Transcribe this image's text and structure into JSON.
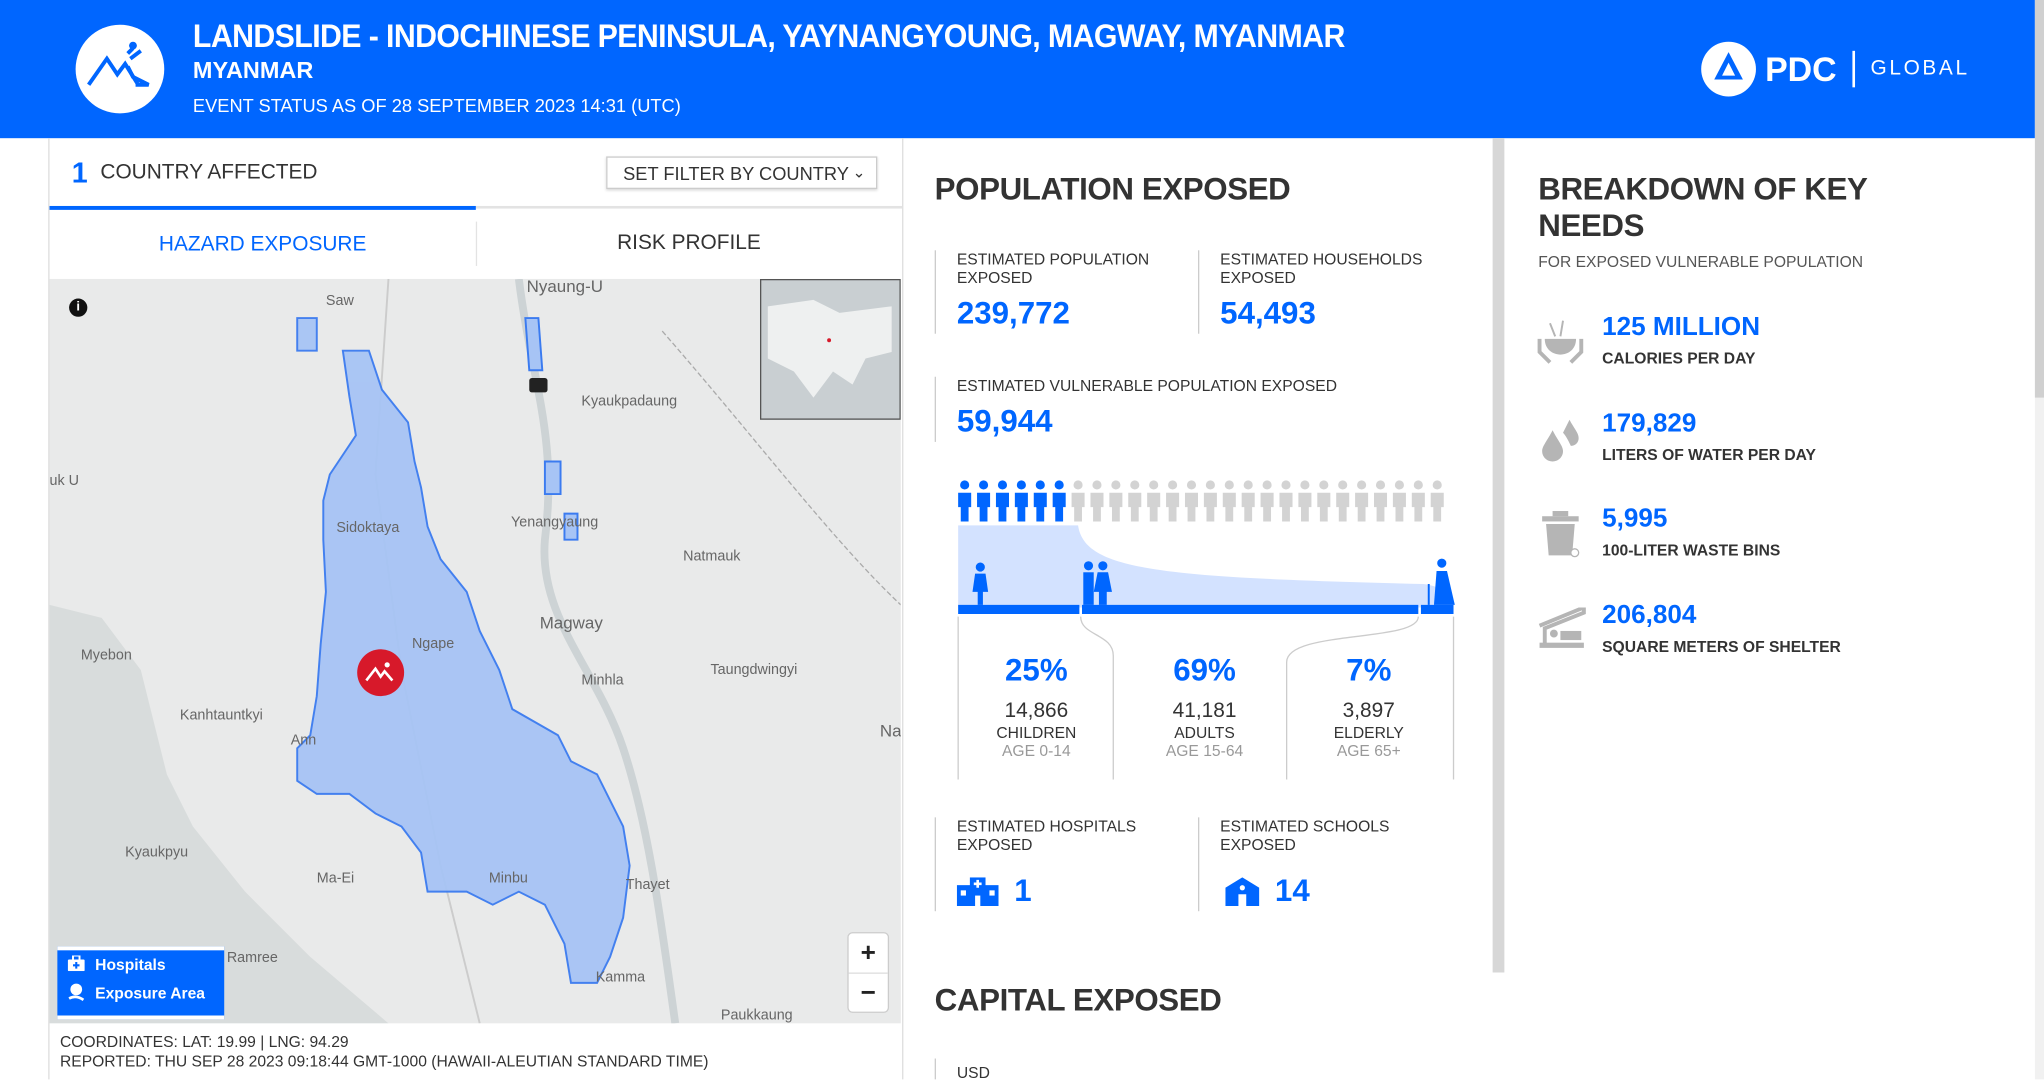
{
  "colors": {
    "brand": "#0066ff",
    "icon_gray": "#b5b5b5",
    "highlight": "#d3e2ff"
  },
  "header": {
    "title": "LANDSLIDE - INDOCHINESE PENINSULA, YAYNANGYOUNG, MAGWAY, MYANMAR",
    "country": "MYANMAR",
    "status": "EVENT STATUS AS OF 28 SEPTEMBER 2023 14:31 (UTC)",
    "logo": {
      "brand": "PDC",
      "suffix": "GLOBAL"
    },
    "hazard_icon": "landslide-icon"
  },
  "left": {
    "country_count": "1",
    "country_label": "COUNTRY AFFECTED",
    "filter_label": "SET FILTER BY COUNTRY",
    "tabs": [
      {
        "label": "HAZARD EXPOSURE",
        "active": true
      },
      {
        "label": "RISK PROFILE",
        "active": false
      }
    ],
    "map": {
      "places": [
        "Nyaung-U",
        "Saw",
        "Kyaukpadaung",
        "uk U",
        "Sidoktaya",
        "Yenangyaung",
        "Natmauk",
        "Magway",
        "Myebon",
        "Ngape",
        "Minhla",
        "Taungdwingyi",
        "Kanhtauntkyi",
        "Ann",
        "Na",
        "Kyaukpyu",
        "Ma-Ei",
        "Minbu",
        "Thayet",
        "Ramree",
        "Kamma",
        "Paukkaung"
      ],
      "legend": [
        {
          "icon": "hospital-icon",
          "label": "Hospitals"
        },
        {
          "icon": "exposure-area-icon",
          "label": "Exposure Area"
        }
      ],
      "zoom_in": "+",
      "zoom_out": "−"
    },
    "coordinates": "COORDINATES: LAT: 19.99 | LNG: 94.29",
    "reported": "REPORTED: THU SEP 28 2023 09:18:44 GMT-1000 (HAWAII-ALEUTIAN STANDARD TIME)"
  },
  "population": {
    "title": "POPULATION EXPOSED",
    "est_pop_label": "ESTIMATED POPULATION EXPOSED",
    "est_pop": "239,772",
    "est_hh_label": "ESTIMATED HOUSEHOLDS EXPOSED",
    "est_hh": "54,493",
    "vuln_label": "ESTIMATED VULNERABLE POPULATION EXPOSED",
    "vuln": "59,944",
    "people_highlighted": 6,
    "people_total": 26,
    "groups": [
      {
        "pct": "25%",
        "count": "14,866",
        "name": "CHILDREN",
        "age": "AGE 0-14"
      },
      {
        "pct": "69%",
        "count": "41,181",
        "name": "ADULTS",
        "age": "AGE 15-64"
      },
      {
        "pct": "7%",
        "count": "3,897",
        "name": "ELDERLY",
        "age": "AGE 65+"
      }
    ],
    "hospitals_label": "ESTIMATED HOSPITALS EXPOSED",
    "hospitals": "1",
    "schools_label": "ESTIMATED SCHOOLS EXPOSED",
    "schools": "14"
  },
  "capital": {
    "title": "CAPITAL EXPOSED",
    "currency": "USD"
  },
  "needs": {
    "title": "BREAKDOWN OF KEY NEEDS",
    "subtitle": "FOR EXPOSED VULNERABLE POPULATION",
    "items": [
      {
        "icon": "food-bowl-icon",
        "value": "125 MILLION",
        "label": "CALORIES PER DAY"
      },
      {
        "icon": "water-drops-icon",
        "value": "179,829",
        "label": "LITERS OF WATER PER DAY"
      },
      {
        "icon": "waste-bin-icon",
        "value": "5,995",
        "label": "100-LITER WASTE BINS"
      },
      {
        "icon": "shelter-icon",
        "value": "206,804",
        "label": "SQUARE METERS OF SHELTER"
      }
    ]
  }
}
